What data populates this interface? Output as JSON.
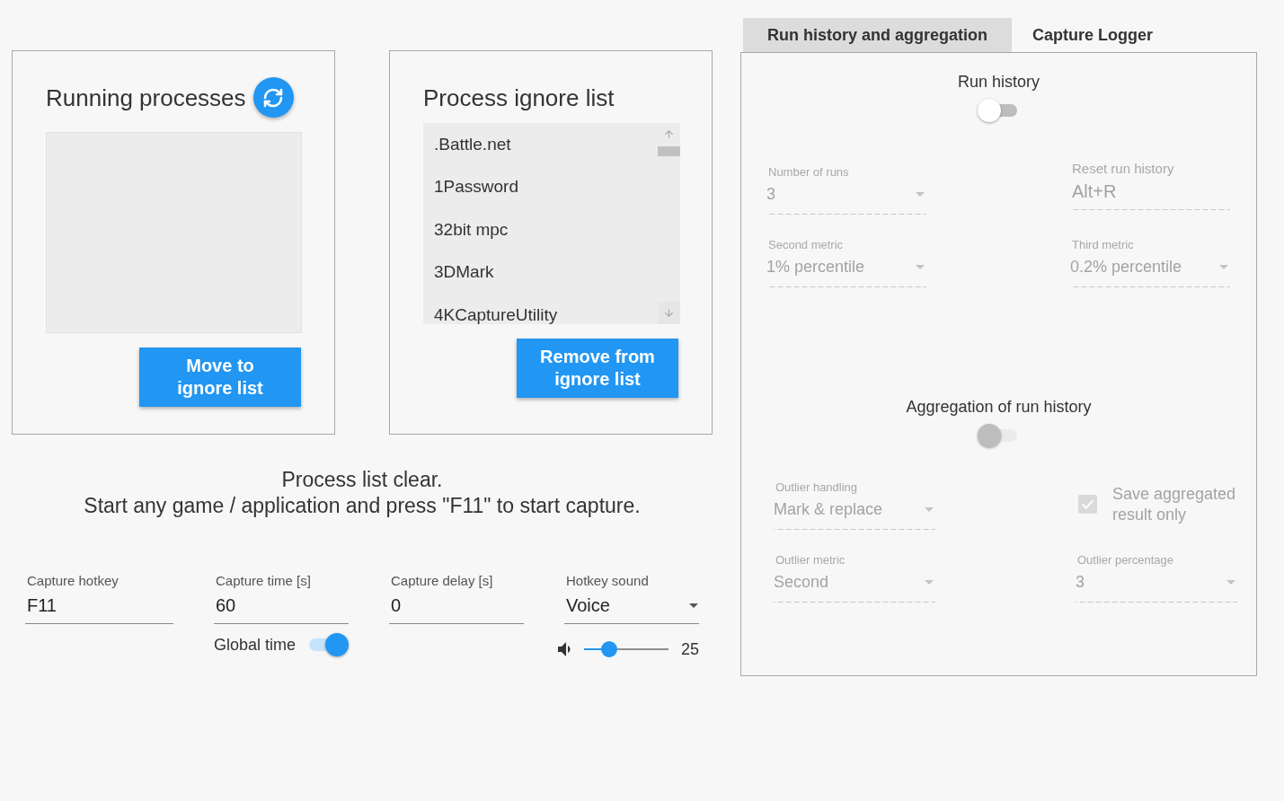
{
  "running_processes": {
    "title": "Running processes",
    "button": "Move to ignore list"
  },
  "ignore_list": {
    "title": "Process ignore list",
    "items": [
      ".Battle.net",
      "1Password",
      "32bit mpc",
      "3DMark",
      "4KCaptureUtility"
    ],
    "button": "Remove from ignore list"
  },
  "status_message": [
    "Process list clear.",
    "Start any game / application and press \"F11\" to start capture."
  ],
  "capture_settings": [
    {
      "kind": "text",
      "label": "Capture hotkey",
      "value": "F11"
    },
    {
      "kind": "text",
      "label": "Capture time [s]",
      "value": "60",
      "switch": {
        "label": "Global time",
        "on": true
      }
    },
    {
      "kind": "text",
      "label": "Capture delay [s]",
      "value": "0"
    },
    {
      "kind": "select",
      "label": "Hotkey sound",
      "value": "Voice",
      "volume": {
        "level": 0.3,
        "reading": "25"
      }
    }
  ],
  "tabs": [
    {
      "label": "Run history and aggregation",
      "selected": true
    },
    {
      "label": "Capture Logger",
      "selected": false
    }
  ],
  "sections": [
    {
      "title": "Run history",
      "switch": {
        "on": false,
        "disabled": false
      },
      "fields": [
        {
          "kind": "select",
          "label": "Number of runs",
          "value": "3",
          "disabled": true
        },
        {
          "kind": "text",
          "label": "Reset run history",
          "value": "Alt+R",
          "disabled": true
        },
        {
          "kind": "select",
          "label": "Second metric",
          "value": "1% percentile",
          "disabled": true
        },
        {
          "kind": "select",
          "label": "Third metric",
          "value": "0.2% percentile",
          "disabled": true
        }
      ]
    },
    {
      "title": "Aggregation of run history",
      "switch": {
        "on": false,
        "disabled": true
      },
      "fields": [
        {
          "kind": "select",
          "label": "Outlier handling",
          "value": "Mark & replace",
          "disabled": true
        },
        {
          "kind": "checkbox",
          "label": "Save aggregated result only",
          "checked": true,
          "disabled": true
        },
        {
          "kind": "select",
          "label": "Outlier metric",
          "value": "Second",
          "disabled": true
        },
        {
          "kind": "select",
          "label": "Outlier percentage",
          "value": "3",
          "disabled": true
        }
      ]
    }
  ]
}
